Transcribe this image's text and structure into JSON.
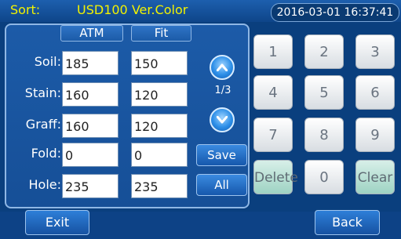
{
  "header": {
    "sort_label": "Sort:",
    "sort_value": "USD100 Ver.Color",
    "datetime": "2016-03-01 16:37:41"
  },
  "table": {
    "columns": [
      "ATM",
      "Fit"
    ],
    "rows": [
      {
        "label": "Soil:",
        "atm": "185",
        "fit": "150"
      },
      {
        "label": "Stain:",
        "atm": "160",
        "fit": "120"
      },
      {
        "label": "Graff:",
        "atm": "160",
        "fit": "120"
      },
      {
        "label": "Fold:",
        "atm": "0",
        "fit": "0"
      },
      {
        "label": "Hole:",
        "atm": "235",
        "fit": "235"
      }
    ]
  },
  "pager": {
    "indicator": "1/3",
    "up_icon": "chevron-up-icon",
    "down_icon": "chevron-down-icon"
  },
  "actions": {
    "save": "Save",
    "all": "All"
  },
  "keypad": {
    "keys": [
      "1",
      "2",
      "3",
      "4",
      "5",
      "6",
      "7",
      "8",
      "9",
      "Delete",
      "0",
      "Clear"
    ]
  },
  "footer": {
    "exit": "Exit",
    "back": "Back"
  },
  "colors": {
    "background": "#0a3f7e",
    "header_text": "#f2f200",
    "panel": "#1c5ba8",
    "key_teal": "#9ed3c3"
  }
}
